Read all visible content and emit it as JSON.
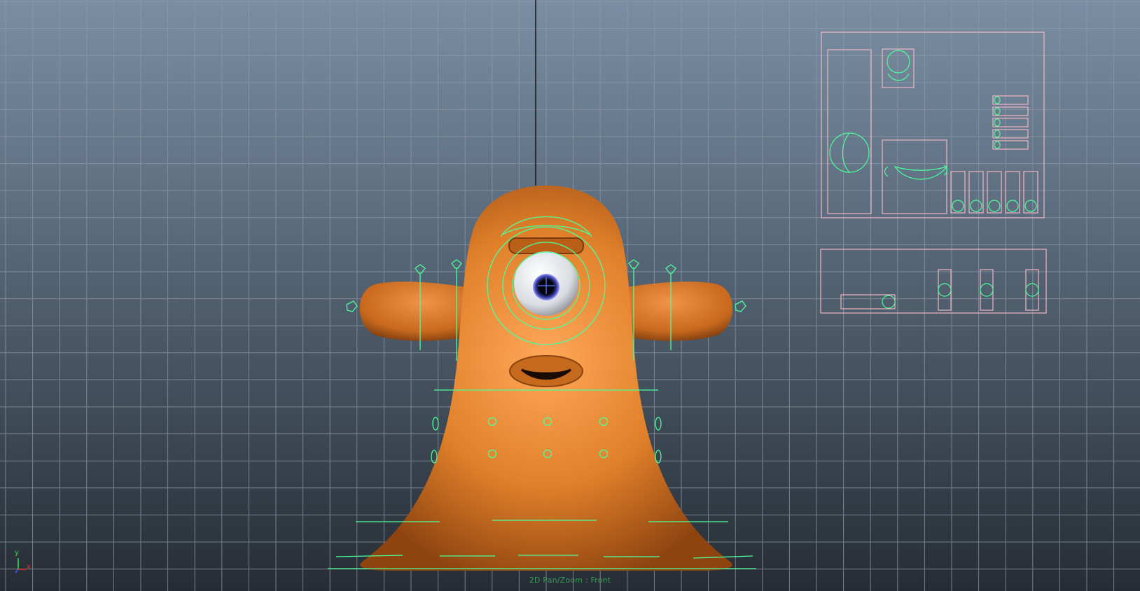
{
  "viewport": {
    "camera_label": "2D Pan/Zoom : Front",
    "axis_y_label": "y",
    "axis_x_label": "x"
  },
  "colors": {
    "grid_line": "#8f9aa8",
    "rig_curve": "#4cff9a",
    "picker_frame": "#f0b6c4",
    "body_orange": "#d9781f",
    "body_highlight": "#ffa859",
    "axis_y": "#2ee05a",
    "axis_x": "#e03030",
    "axis_z": "#3c64ff"
  },
  "scene": {
    "character_name": "orange-one-eyed-monster",
    "controls": [
      "brow-control",
      "eye-control",
      "arm-controls-left",
      "arm-controls-right",
      "belly-controls",
      "base-controls"
    ],
    "picker_panels": [
      "picker-panel-top",
      "picker-panel-bottom"
    ]
  }
}
